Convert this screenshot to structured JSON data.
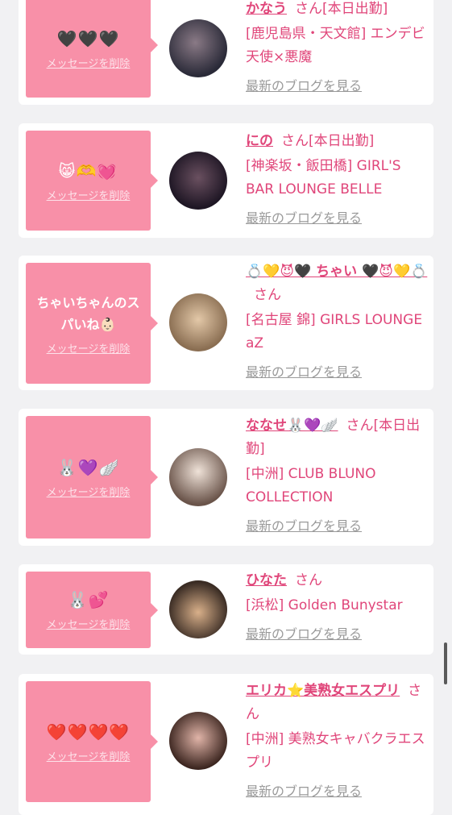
{
  "entries": [
    {
      "message": "🖤🖤🖤",
      "delete_label": "メッセージを削除",
      "name": "かなう",
      "honorific": "さん[本日出勤]",
      "shop": "[鹿児島県・天文館] エンデビ　天使×悪魔",
      "blog_label": "最新のブログを見る",
      "avatar_colors": [
        "#2a2a38",
        "#8a7a86"
      ]
    },
    {
      "message": "😸🫶💓",
      "delete_label": "メッセージを削除",
      "name": "にの",
      "honorific": "さん[本日出勤]",
      "shop": "[神楽坂・飯田橋] GIRL'S BAR LOUNGE BELLE",
      "blog_label": "最新のブログを見る",
      "avatar_colors": [
        "#2a1e2e",
        "#5a4050"
      ]
    },
    {
      "message": "ちゃいちゃんのスパいね👶🏻",
      "delete_label": "メッセージを削除",
      "name": "💍💛😈🖤 ちゃい 🖤😈💛💍",
      "honorific": "さん",
      "shop": "[名古屋 錦] GIRLS LOUNGE aZ",
      "blog_label": "最新のブログを見る",
      "avatar_colors": [
        "#c9a57e",
        "#6e5a44"
      ]
    },
    {
      "message": "🐰💜🪽",
      "delete_label": "メッセージを削除",
      "name": "ななせ🐰💜🪽",
      "honorific": "さん[本日出勤]",
      "shop": "[中洲] CLUB BLUNO COLLECTION",
      "blog_label": "最新のブログを見る",
      "avatar_colors": [
        "#d8c7bd",
        "#3a2a24"
      ]
    },
    {
      "message": "🐰💕",
      "delete_label": "メッセージを削除",
      "name": "ひなた",
      "honorific": "さん",
      "shop": "[浜松] Golden Bunystar",
      "blog_label": "最新のブログを見る",
      "avatar_colors": [
        "#b88e66",
        "#2a2420"
      ]
    },
    {
      "message": "❤️❤️❤️❤️",
      "delete_label": "メッセージを削除",
      "name": "エリカ⭐️美熟女エスプリ",
      "honorific": "さん",
      "shop": "[中洲] 美熟女キャバクラエスプリ",
      "blog_label": "最新のブログを見る",
      "avatar_colors": [
        "#4a2e28",
        "#e0b4a8"
      ]
    }
  ]
}
